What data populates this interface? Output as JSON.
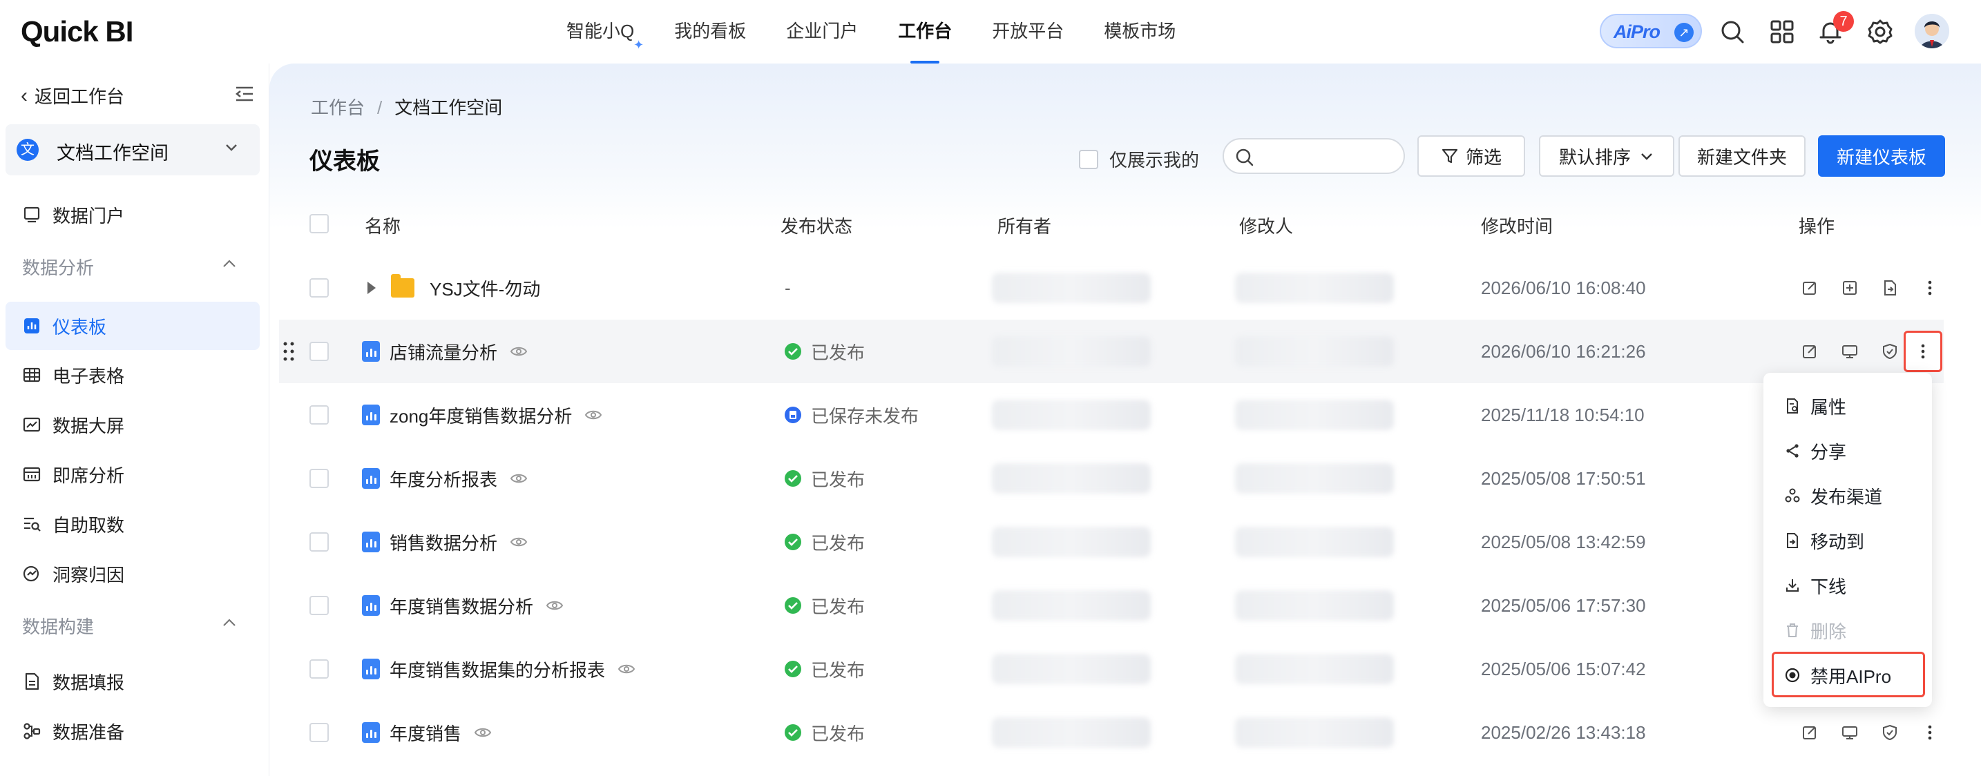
{
  "app": {
    "logo": "Quick BI"
  },
  "topnav": [
    {
      "label": "智能小Q",
      "active": false
    },
    {
      "label": "我的看板",
      "active": false
    },
    {
      "label": "企业门户",
      "active": false
    },
    {
      "label": "工作台",
      "active": true
    },
    {
      "label": "开放平台",
      "active": false
    },
    {
      "label": "模板市场",
      "active": false
    }
  ],
  "header": {
    "aipro_label": "AiPro",
    "notification_count": "7"
  },
  "sidebar": {
    "back_label": "返回工作台",
    "workspace_icon": "文",
    "workspace_name": "文档工作空间",
    "portal": "数据门户",
    "group_analysis": "数据分析",
    "analysis_items": [
      "仪表板",
      "电子表格",
      "数据大屏",
      "即席分析",
      "自助取数",
      "洞察归因"
    ],
    "group_build": "数据构建",
    "build_items": [
      "数据填报",
      "数据准备"
    ]
  },
  "main": {
    "breadcrumb_root": "工作台",
    "breadcrumb_sep": "/",
    "breadcrumb_current": "文档工作空间",
    "title": "仪表板",
    "only_mine_label": "仅展示我的",
    "search_placeholder": "",
    "filter_label": "筛选",
    "sort_label": "默认排序",
    "new_folder_label": "新建文件夹",
    "new_dashboard_label": "新建仪表板"
  },
  "table": {
    "columns": {
      "name": "名称",
      "status": "发布状态",
      "owner": "所有者",
      "modifier": "修改人",
      "time": "修改时间",
      "ops": "操作"
    },
    "rows": [
      {
        "type": "folder",
        "name": "YSJ文件-勿动",
        "status": "-",
        "time": "2026/06/10 16:08:40"
      },
      {
        "type": "dashboard",
        "name": "店铺流量分析",
        "status": "已发布",
        "time": "2026/06/10 16:21:26"
      },
      {
        "type": "dashboard",
        "name": "zong年度销售数据分析",
        "status": "已保存未发布",
        "time": "2025/11/18 10:54:10"
      },
      {
        "type": "dashboard",
        "name": "年度分析报表",
        "status": "已发布",
        "time": "2025/05/08 17:50:51"
      },
      {
        "type": "dashboard",
        "name": "销售数据分析",
        "status": "已发布",
        "time": "2025/05/08 13:42:59"
      },
      {
        "type": "dashboard",
        "name": "年度销售数据分析",
        "status": "已发布",
        "time": "2025/05/06 17:57:30"
      },
      {
        "type": "dashboard",
        "name": "年度销售数据集的分析报表",
        "status": "已发布",
        "time": "2025/05/06 15:07:42"
      },
      {
        "type": "dashboard",
        "name": "年度销售",
        "status": "已发布",
        "time": "2025/02/26 13:43:18"
      }
    ]
  },
  "menu": {
    "items": [
      {
        "label": "属性",
        "icon": "properties-icon",
        "disabled": false
      },
      {
        "label": "分享",
        "icon": "share-icon",
        "disabled": false
      },
      {
        "label": "发布渠道",
        "icon": "channel-icon",
        "disabled": false
      },
      {
        "label": "移动到",
        "icon": "move-icon",
        "disabled": false
      },
      {
        "label": "下线",
        "icon": "offline-icon",
        "disabled": false
      },
      {
        "label": "删除",
        "icon": "delete-icon",
        "disabled": true
      },
      {
        "label": "禁用AIPro",
        "icon": "radio-icon",
        "disabled": false
      }
    ]
  },
  "colors": {
    "accent": "#1b6ef3",
    "success": "#31b852",
    "highlight": "#f24b3d"
  }
}
